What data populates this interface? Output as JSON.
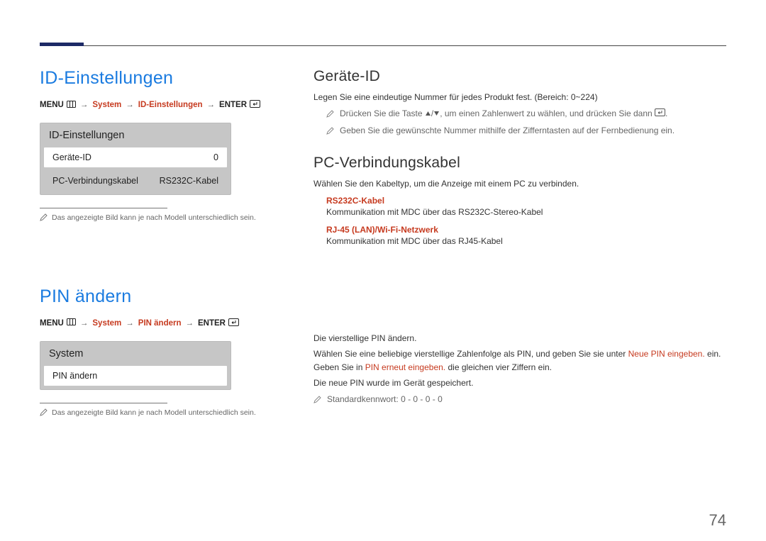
{
  "pageNumber": "74",
  "left": {
    "section1": {
      "title": "ID-Einstellungen",
      "breadcrumb": {
        "menu": "MENU",
        "lvl1": "System",
        "lvl2": "ID-Einstellungen",
        "enter": "ENTER"
      },
      "osd": {
        "header": "ID-Einstellungen",
        "row1_label": "Geräte-ID",
        "row1_value": "0",
        "row2_label": "PC-Verbindungskabel",
        "row2_value": "RS232C-Kabel"
      },
      "footnote": "Das angezeigte Bild kann je nach Modell unterschiedlich sein."
    },
    "section2": {
      "title": "PIN ändern",
      "breadcrumb": {
        "menu": "MENU",
        "lvl1": "System",
        "lvl2": "PIN ändern",
        "enter": "ENTER"
      },
      "osd": {
        "header": "System",
        "row1_label": "PIN ändern"
      },
      "footnote": "Das angezeigte Bild kann je nach Modell unterschiedlich sein."
    }
  },
  "right": {
    "deviceId": {
      "title": "Geräte-ID",
      "desc": "Legen Sie eine eindeutige Nummer für jedes Produkt fest. (Bereich: 0~224)",
      "note1_a": "Drücken Sie die Taste ",
      "note1_b": ", um einen Zahlenwert zu wählen, und drücken Sie dann ",
      "note1_c": ".",
      "note2": "Geben Sie die gewünschte Nummer mithilfe der Zifferntasten auf der Fernbedienung ein."
    },
    "pcCable": {
      "title": "PC-Verbindungskabel",
      "desc": "Wählen Sie den Kabeltyp, um die Anzeige mit einem PC zu verbinden.",
      "opt1_term": "RS232C-Kabel",
      "opt1_desc": "Kommunikation mit MDC über das RS232C-Stereo-Kabel",
      "opt2_term": "RJ-45 (LAN)/Wi-Fi-Netzwerk",
      "opt2_desc": "Kommunikation mit MDC über das RJ45-Kabel"
    },
    "pin": {
      "line1": "Die vierstellige PIN ändern.",
      "line2_a": "Wählen Sie eine beliebige vierstellige Zahlenfolge als PIN, und geben Sie sie unter ",
      "line2_red1": "Neue PIN eingeben.",
      "line2_b": " ein. Geben Sie in ",
      "line2_red2": "PIN erneut eingeben.",
      "line2_c": " die gleichen vier Ziffern ein.",
      "line3": "Die neue PIN wurde im Gerät gespeichert.",
      "note": "Standardkennwort: 0 - 0 - 0 - 0"
    }
  }
}
